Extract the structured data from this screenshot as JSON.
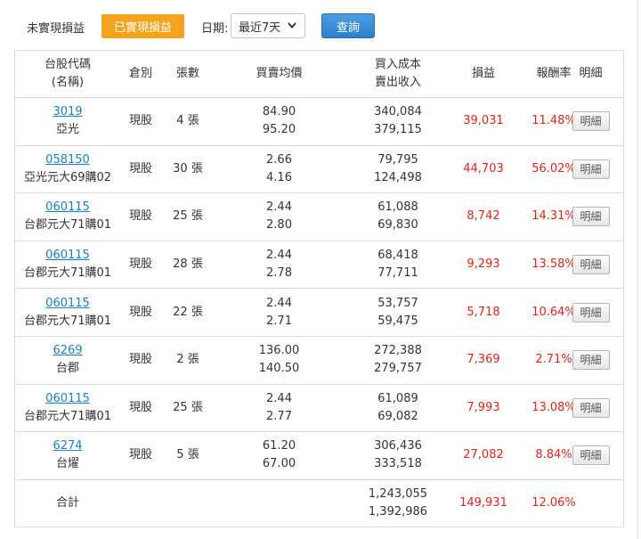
{
  "toolbar": {
    "unrealized_tab": "未實現損益",
    "realized_tab": "已實現損益",
    "date_label": "日期:",
    "date_value": "最近7天",
    "query_button": "查詢",
    "accent_color": "#f7a21c",
    "button_color": "#2f7fd0"
  },
  "table": {
    "headers": {
      "code_line1": "台股代碼",
      "code_line2": "(名稱)",
      "category": "倉別",
      "quantity": "張數",
      "avg_price": "買賣均價",
      "cost_line1": "買入成本",
      "cost_line2": "賣出收入",
      "pnl": "損益",
      "return": "報酬率",
      "detail": "明細"
    },
    "rows": [
      {
        "code": "3019",
        "name": "亞光",
        "category": "現股",
        "quantity": "4 張",
        "buy_price": "84.90",
        "sell_price": "95.20",
        "buy_cost": "340,084",
        "sell_income": "379,115",
        "pnl": "39,031",
        "return": "11.48%",
        "detail": "明細"
      },
      {
        "code": "058150",
        "name": "亞光元大69購02",
        "category": "現股",
        "quantity": "30 張",
        "buy_price": "2.66",
        "sell_price": "4.16",
        "buy_cost": "79,795",
        "sell_income": "124,498",
        "pnl": "44,703",
        "return": "56.02%",
        "detail": "明細"
      },
      {
        "code": "060115",
        "name": "台郡元大71購01",
        "category": "現股",
        "quantity": "25 張",
        "buy_price": "2.44",
        "sell_price": "2.80",
        "buy_cost": "61,088",
        "sell_income": "69,830",
        "pnl": "8,742",
        "return": "14.31%",
        "detail": "明細"
      },
      {
        "code": "060115",
        "name": "台郡元大71購01",
        "category": "現股",
        "quantity": "28 張",
        "buy_price": "2.44",
        "sell_price": "2.78",
        "buy_cost": "68,418",
        "sell_income": "77,711",
        "pnl": "9,293",
        "return": "13.58%",
        "detail": "明細"
      },
      {
        "code": "060115",
        "name": "台郡元大71購01",
        "category": "現股",
        "quantity": "22 張",
        "buy_price": "2.44",
        "sell_price": "2.71",
        "buy_cost": "53,757",
        "sell_income": "59,475",
        "pnl": "5,718",
        "return": "10.64%",
        "detail": "明細"
      },
      {
        "code": "6269",
        "name": "台郡",
        "category": "現股",
        "quantity": "2 張",
        "buy_price": "136.00",
        "sell_price": "140.50",
        "buy_cost": "272,388",
        "sell_income": "279,757",
        "pnl": "7,369",
        "return": "2.71%",
        "detail": "明細"
      },
      {
        "code": "060115",
        "name": "台郡元大71購01",
        "category": "現股",
        "quantity": "25 張",
        "buy_price": "2.44",
        "sell_price": "2.77",
        "buy_cost": "61,089",
        "sell_income": "69,082",
        "pnl": "7,993",
        "return": "13.08%",
        "detail": "明細"
      },
      {
        "code": "6274",
        "name": "台燿",
        "category": "現股",
        "quantity": "5 張",
        "buy_price": "61.20",
        "sell_price": "67.00",
        "buy_cost": "306,436",
        "sell_income": "333,518",
        "pnl": "27,082",
        "return": "8.84%",
        "detail": "明細"
      }
    ],
    "total": {
      "label": "合計",
      "buy_cost": "1,243,055",
      "sell_income": "1,392,986",
      "pnl": "149,931",
      "return": "12.06%"
    }
  }
}
